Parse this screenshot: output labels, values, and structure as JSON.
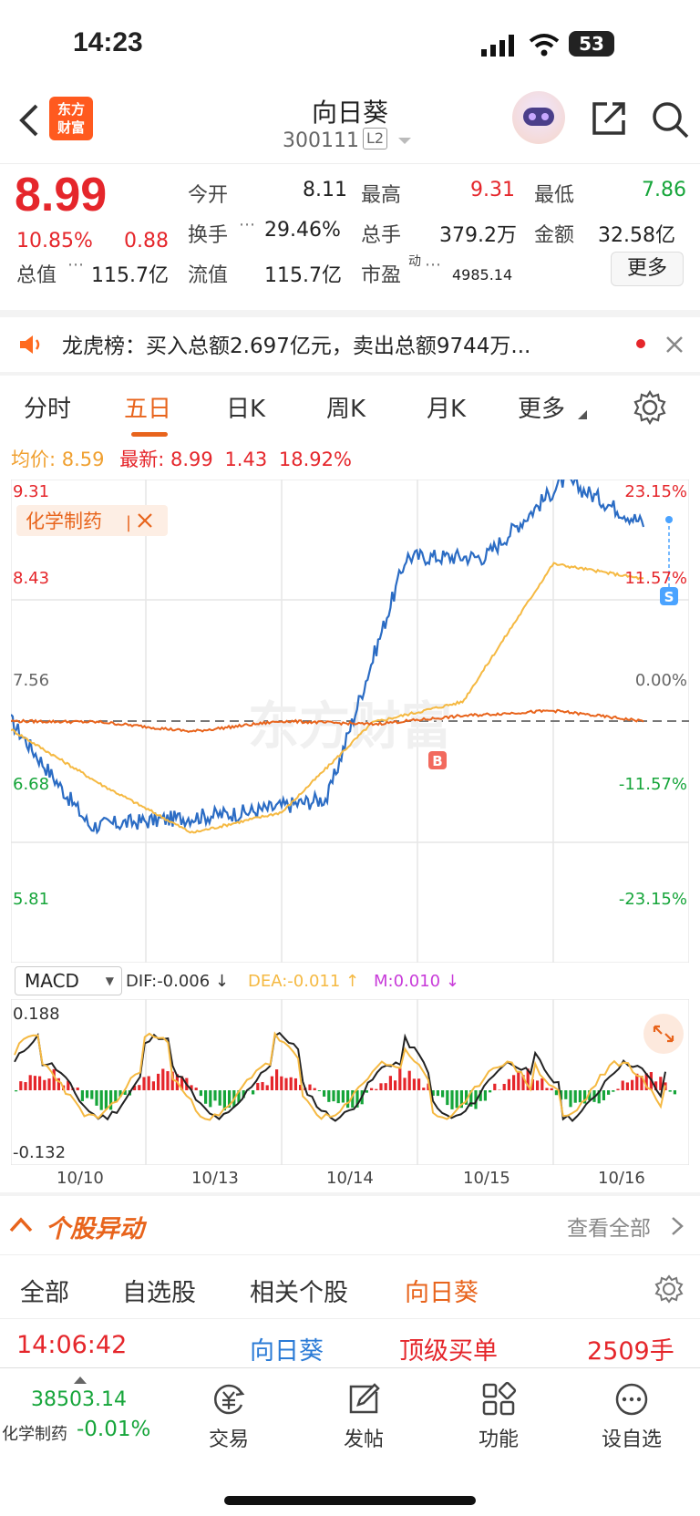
{
  "status": {
    "time": "14:23",
    "battery": "53"
  },
  "header": {
    "logo_line1": "东方",
    "logo_line2": "财富",
    "stock_name": "向日葵",
    "stock_code": "300111",
    "level_badge": "L2"
  },
  "quote": {
    "price": "8.99",
    "change_pct": "10.85%",
    "change_amt": "0.88",
    "open_label": "今开",
    "open": "8.11",
    "high_label": "最高",
    "high": "9.31",
    "low_label": "最低",
    "low": "7.86",
    "turnover_label": "换手",
    "turnover": "29.46%",
    "volume_label": "总手",
    "volume": "379.2万",
    "amount_label": "金额",
    "amount": "32.58亿",
    "mktcap_label": "总值",
    "mktcap": "115.7亿",
    "float_label": "流值",
    "float": "115.7亿",
    "pe_label": "市盈",
    "pe_sup": "动",
    "pe": "4985.14",
    "more_button": "更多"
  },
  "notice": {
    "text": "龙虎榜：买入总额2.697亿元，卖出总额9744万..."
  },
  "tabs": [
    "分时",
    "五日",
    "日K",
    "周K",
    "月K",
    "更多"
  ],
  "active_tab": "五日",
  "summary": {
    "avg_label": "均价:",
    "avg": "8.59",
    "latest_label": "最新:",
    "latest": "8.99",
    "chg": "1.43",
    "chg_pct": "18.92%"
  },
  "chart": {
    "y_left": [
      "9.31",
      "8.43",
      "7.56",
      "6.68",
      "5.81"
    ],
    "y_right": [
      "23.15%",
      "11.57%",
      "0.00%",
      "-11.57%",
      "-23.15%"
    ],
    "sector_tag": "化学制药",
    "watermark": "东方财富",
    "buy_marker": "B",
    "sell_marker": "S"
  },
  "macd": {
    "selector": "MACD",
    "dif": "DIF:-0.006 ↓",
    "dea": "DEA:-0.011 ↑",
    "m": "M:0.010 ↓",
    "y_top": "0.188",
    "y_bottom": "-0.132"
  },
  "x_labels": [
    "10/10",
    "10/13",
    "10/14",
    "10/15",
    "10/16"
  ],
  "movement": {
    "title": "个股异动",
    "view_all": "查看全部"
  },
  "filter_tabs": [
    "全部",
    "自选股",
    "相关个股",
    "向日葵"
  ],
  "event": {
    "time": "14:06:42",
    "stock": "向日葵",
    "type": "顶级买单",
    "size": "2509手"
  },
  "bottom": {
    "index_value": "38503.14",
    "index_name": "化学制药",
    "index_change": "-0.01%",
    "trade": "交易",
    "post": "发帖",
    "function": "功能",
    "watchlist": "设自选"
  },
  "chart_data": {
    "type": "line",
    "x": [
      "10/10",
      "10/13",
      "10/14",
      "10/15",
      "10/16"
    ],
    "series": [
      {
        "name": "最新",
        "color": "#2b6cc4",
        "values": [
          7.56,
          6.8,
          6.85,
          6.9,
          7.0,
          8.75,
          8.75,
          9.31,
          8.99
        ]
      },
      {
        "name": "均价",
        "color": "#f5b942",
        "values": [
          7.5,
          7.1,
          6.75,
          6.9,
          7.55,
          7.7,
          8.7,
          8.59
        ]
      },
      {
        "name": "化学制药",
        "color": "#e8641c",
        "values": [
          0.0,
          -0.1,
          -1.0,
          0.0,
          -0.3,
          0.5,
          1.0,
          0.0
        ]
      }
    ],
    "ylim": [
      5.81,
      9.31
    ],
    "prev_close": 7.56
  }
}
